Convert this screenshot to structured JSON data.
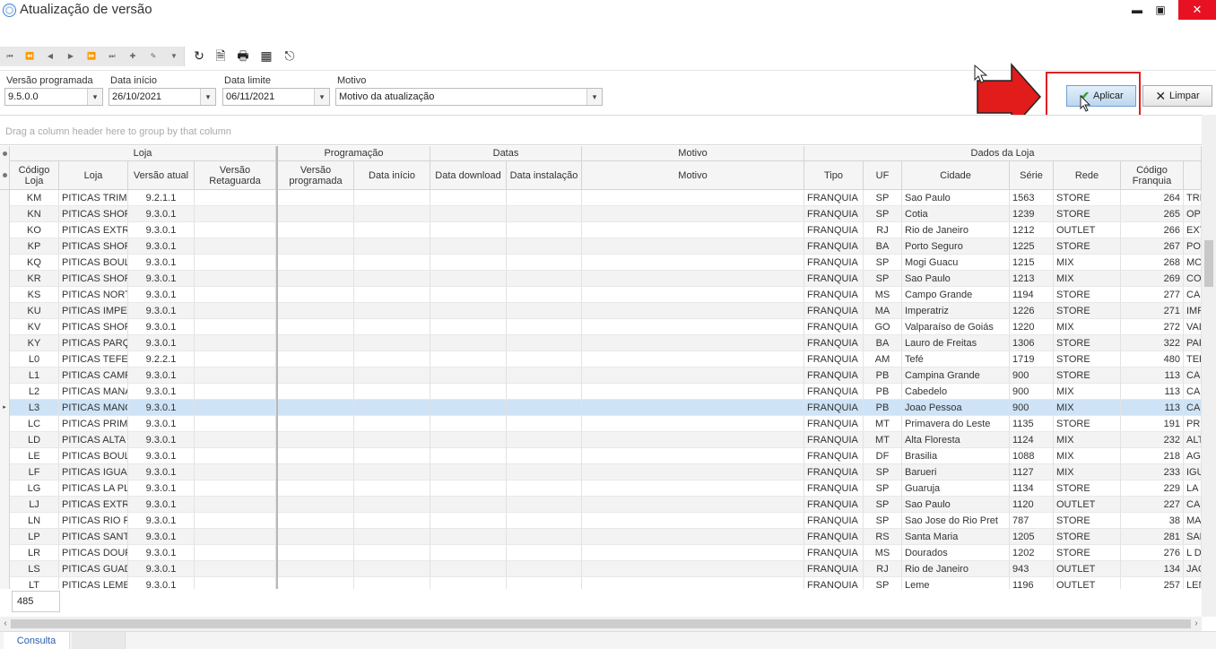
{
  "window": {
    "title": "Atualização de versão",
    "min": "▬",
    "max": "▣",
    "close": "✕"
  },
  "toolbar": {
    "nav": [
      "⏮",
      "⏪",
      "◀",
      "▶",
      "⏩",
      "⏭",
      "✚",
      "✎",
      "▼"
    ],
    "tools": [
      {
        "icon": "refresh-icon",
        "glyph": "↻"
      },
      {
        "icon": "preview-icon",
        "glyph": "🗎"
      },
      {
        "icon": "printer-icon",
        "glyph": "🖶"
      },
      {
        "icon": "export-icon",
        "glyph": "▦"
      },
      {
        "icon": "exit-icon",
        "glyph": "⎋"
      }
    ]
  },
  "filters": {
    "versao_label": "Versão programada",
    "versao_value": "9.5.0.0",
    "inicio_label": "Data início",
    "inicio_value": "26/10/2021",
    "limite_label": "Data limite",
    "limite_value": "06/11/2021",
    "motivo_label": "Motivo",
    "motivo_value": "Motivo da atualização",
    "dropdown_glyph": "▾"
  },
  "buttons": {
    "aplicar": "Aplicar",
    "limpar": "Limpar",
    "check_glyph": "✔",
    "x_glyph": "✕"
  },
  "annotation": {
    "arrow_color": "#e21b1b",
    "box_color": "#e02020"
  },
  "grid": {
    "group_hint": "Drag a column header here to group by that column",
    "bands": {
      "loja": "Loja",
      "programacao": "Programação",
      "datas": "Datas",
      "motivo": "Motivo",
      "dados": "Dados da Loja"
    },
    "columns": {
      "codigo": "Código Loja",
      "loja": "Loja",
      "versao_atual": "Versão atual",
      "versao_ret": "Versão Retaguarda",
      "versao_prog": "Versão programada",
      "data_inicio": "Data início",
      "data_download": "Data download",
      "data_instalacao": "Data instalação",
      "motivo": "Motivo",
      "tipo": "Tipo",
      "uf": "UF",
      "cidade": "Cidade",
      "serie": "Série",
      "rede": "Rede",
      "codigo_franquia": "Código Franquia"
    },
    "rows": [
      {
        "codigo": "KM",
        "loja": "PITICAS TRIM.",
        "versao": "9.2.1.1",
        "tipo": "FRANQUIA",
        "uf": "SP",
        "cidade": "Sao Paulo",
        "serie": "1563",
        "rede": "STORE",
        "cod_fr": "264",
        "extra": "TRI"
      },
      {
        "codigo": "KN",
        "loja": "PITICAS SHOP",
        "versao": "9.3.0.1",
        "tipo": "FRANQUIA",
        "uf": "SP",
        "cidade": "Cotia",
        "serie": "1239",
        "rede": "STORE",
        "cod_fr": "265",
        "extra": "OPE"
      },
      {
        "codigo": "KO",
        "loja": "PITICAS EXTR.",
        "versao": "9.3.0.1",
        "tipo": "FRANQUIA",
        "uf": "RJ",
        "cidade": "Rio de Janeiro",
        "serie": "1212",
        "rede": "OUTLET",
        "cod_fr": "266",
        "extra": "EXT"
      },
      {
        "codigo": "KP",
        "loja": "PITICAS SHOP",
        "versao": "9.3.0.1",
        "tipo": "FRANQUIA",
        "uf": "BA",
        "cidade": "Porto Seguro",
        "serie": "1225",
        "rede": "STORE",
        "cod_fr": "267",
        "extra": "POF"
      },
      {
        "codigo": "KQ",
        "loja": "PITICAS BOUL",
        "versao": "9.3.0.1",
        "tipo": "FRANQUIA",
        "uf": "SP",
        "cidade": "Mogi Guacu",
        "serie": "1215",
        "rede": "MIX",
        "cod_fr": "268",
        "extra": "MO("
      },
      {
        "codigo": "KR",
        "loja": "PITICAS SHOP",
        "versao": "9.3.0.1",
        "tipo": "FRANQUIA",
        "uf": "SP",
        "cidade": "Sao Paulo",
        "serie": "1213",
        "rede": "MIX",
        "cod_fr": "269",
        "extra": "CON"
      },
      {
        "codigo": "KS",
        "loja": "PITICAS NORT",
        "versao": "9.3.0.1",
        "tipo": "FRANQUIA",
        "uf": "MS",
        "cidade": "Campo Grande",
        "serie": "1194",
        "rede": "STORE",
        "cod_fr": "277",
        "extra": "CAN"
      },
      {
        "codigo": "KU",
        "loja": "PITICAS IMPEI",
        "versao": "9.3.0.1",
        "tipo": "FRANQUIA",
        "uf": "MA",
        "cidade": "Imperatriz",
        "serie": "1226",
        "rede": "STORE",
        "cod_fr": "271",
        "extra": "IMP"
      },
      {
        "codigo": "KV",
        "loja": "PITICAS SHOP",
        "versao": "9.3.0.1",
        "tipo": "FRANQUIA",
        "uf": "GO",
        "cidade": "Valparaíso de Goiás",
        "serie": "1220",
        "rede": "MIX",
        "cod_fr": "272",
        "extra": "VAL"
      },
      {
        "codigo": "KY",
        "loja": "PITICAS PARÇ",
        "versao": "9.3.0.1",
        "tipo": "FRANQUIA",
        "uf": "BA",
        "cidade": "Lauro de Freitas",
        "serie": "1306",
        "rede": "STORE",
        "cod_fr": "322",
        "extra": "PAF"
      },
      {
        "codigo": "L0",
        "loja": "PITICAS TEFE",
        "versao": "9.2.2.1",
        "tipo": "FRANQUIA",
        "uf": "AM",
        "cidade": "Tefé",
        "serie": "1719",
        "rede": "STORE",
        "cod_fr": "480",
        "extra": "TEF"
      },
      {
        "codigo": "L1",
        "loja": "PITICAS CAMF",
        "versao": "9.3.0.1",
        "tipo": "FRANQUIA",
        "uf": "PB",
        "cidade": "Campina Grande",
        "serie": "900",
        "rede": "STORE",
        "cod_fr": "113",
        "extra": "CAN"
      },
      {
        "codigo": "L2",
        "loja": "PITICAS MANA",
        "versao": "9.3.0.1",
        "tipo": "FRANQUIA",
        "uf": "PB",
        "cidade": "Cabedelo",
        "serie": "900",
        "rede": "MIX",
        "cod_fr": "113",
        "extra": "CAN"
      },
      {
        "codigo": "L3",
        "loja": "PITICAS MANC",
        "versao": "9.3.0.1",
        "tipo": "FRANQUIA",
        "uf": "PB",
        "cidade": "Joao Pessoa",
        "serie": "900",
        "rede": "MIX",
        "cod_fr": "113",
        "extra": "CAN"
      },
      {
        "codigo": "LC",
        "loja": "PITICAS PRIM.",
        "versao": "9.3.0.1",
        "tipo": "FRANQUIA",
        "uf": "MT",
        "cidade": "Primavera do Leste",
        "serie": "1135",
        "rede": "STORE",
        "cod_fr": "191",
        "extra": "PRI"
      },
      {
        "codigo": "LD",
        "loja": "PITICAS ALTA",
        "versao": "9.3.0.1",
        "tipo": "FRANQUIA",
        "uf": "MT",
        "cidade": "Alta Floresta",
        "serie": "1124",
        "rede": "MIX",
        "cod_fr": "232",
        "extra": "ALT"
      },
      {
        "codigo": "LE",
        "loja": "PITICAS BOUL",
        "versao": "9.3.0.1",
        "tipo": "FRANQUIA",
        "uf": "DF",
        "cidade": "Brasilia",
        "serie": "1088",
        "rede": "MIX",
        "cod_fr": "218",
        "extra": "AGL"
      },
      {
        "codigo": "LF",
        "loja": "PITICAS IGUA'",
        "versao": "9.3.0.1",
        "tipo": "FRANQUIA",
        "uf": "SP",
        "cidade": "Barueri",
        "serie": "1127",
        "rede": "MIX",
        "cod_fr": "233",
        "extra": "IGU"
      },
      {
        "codigo": "LG",
        "loja": "PITICAS LA PL",
        "versao": "9.3.0.1",
        "tipo": "FRANQUIA",
        "uf": "SP",
        "cidade": "Guaruja",
        "serie": "1134",
        "rede": "STORE",
        "cod_fr": "229",
        "extra": "LA F"
      },
      {
        "codigo": "LJ",
        "loja": "PITICAS EXTR.",
        "versao": "9.3.0.1",
        "tipo": "FRANQUIA",
        "uf": "SP",
        "cidade": "Sao Paulo",
        "serie": "1120",
        "rede": "OUTLET",
        "cod_fr": "227",
        "extra": "CAF"
      },
      {
        "codigo": "LN",
        "loja": "PITICAS RIO F",
        "versao": "9.3.0.1",
        "tipo": "FRANQUIA",
        "uf": "SP",
        "cidade": "Sao Jose do Rio Pret",
        "serie": "787",
        "rede": "STORE",
        "cod_fr": "38",
        "extra": "MAI"
      },
      {
        "codigo": "LP",
        "loja": "PITICAS SANT",
        "versao": "9.3.0.1",
        "tipo": "FRANQUIA",
        "uf": "RS",
        "cidade": "Santa Maria",
        "serie": "1205",
        "rede": "STORE",
        "cod_fr": "281",
        "extra": "SAN"
      },
      {
        "codigo": "LR",
        "loja": "PITICAS DOUF",
        "versao": "9.3.0.1",
        "tipo": "FRANQUIA",
        "uf": "MS",
        "cidade": "Dourados",
        "serie": "1202",
        "rede": "STORE",
        "cod_fr": "276",
        "extra": "L DC"
      },
      {
        "codigo": "LS",
        "loja": "PITICAS GUAD",
        "versao": "9.3.0.1",
        "tipo": "FRANQUIA",
        "uf": "RJ",
        "cidade": "Rio de Janeiro",
        "serie": "943",
        "rede": "OUTLET",
        "cod_fr": "134",
        "extra": "JAC"
      },
      {
        "codigo": "LT",
        "loja": "PITICAS LEME",
        "versao": "9.3.0.1",
        "tipo": "FRANQUIA",
        "uf": "SP",
        "cidade": "Leme",
        "serie": "1196",
        "rede": "OUTLET",
        "cod_fr": "257",
        "extra": "LEN"
      }
    ]
  },
  "footer": {
    "count": "485",
    "tab": "Consulta"
  }
}
